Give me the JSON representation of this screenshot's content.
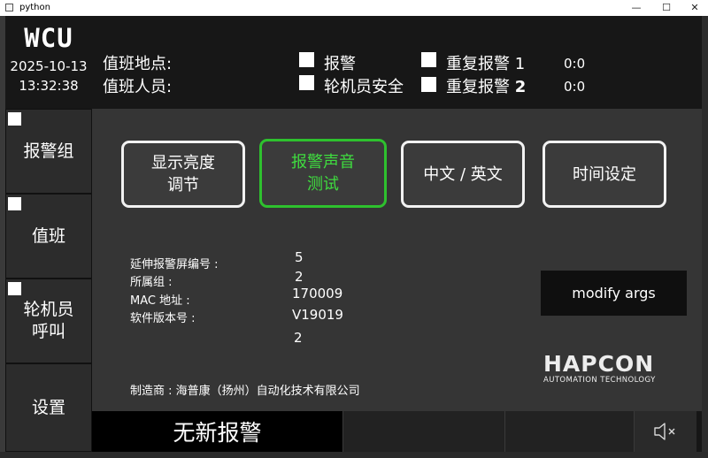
{
  "window": {
    "title": "python",
    "minimize": "—",
    "maximize": "☐",
    "close": "✕"
  },
  "header": {
    "logo": "WCU",
    "date": "2025-10-13",
    "time": "13:32:38",
    "duty_location_label": "值班地点:",
    "duty_person_label": "值班人员:",
    "alarm_label": "报警",
    "engineer_safe_label": "轮机员安全",
    "repeat_alarm_1_label": "重复报警",
    "repeat_alarm_1_num": "1",
    "repeat_alarm_2_label": "重复报警",
    "repeat_alarm_2_num": "2",
    "counter_1": "0:0",
    "counter_2": "0:0"
  },
  "nav": {
    "items": [
      {
        "label": "报警组"
      },
      {
        "label": "值班"
      },
      {
        "label": "轮机员\n呼叫"
      },
      {
        "label": "设置"
      }
    ]
  },
  "settings": {
    "buttons": [
      {
        "label": "显示亮度\n调节",
        "active": false
      },
      {
        "label": "报警声音\n测试",
        "active": true
      },
      {
        "label": "中文 / 英文",
        "active": false
      },
      {
        "label": "时间设定",
        "active": false
      }
    ],
    "info": {
      "screen_no_label": "延伸报警屏编号 :",
      "screen_no_value": "5",
      "group_label": "所属组 :",
      "group_value": "2",
      "mac_label": "MAC 地址 :",
      "mac_value": "170009",
      "version_label": "软件版本号 :",
      "version_value": "V19019",
      "extra_value": "2"
    },
    "modify_button": "modify args",
    "brand_name": "HAPCON",
    "brand_sub": "AUTOMATION TECHNOLOGY",
    "manufacturer": "制造商 : 海普康（扬州）自动化技术有限公司"
  },
  "status_bar": {
    "alarm_status": "无新报警",
    "mute_icon": "speaker-muted-icon"
  },
  "colors": {
    "active_border": "#2ec12e",
    "active_text": "#3fdc3f",
    "panel": "#353535",
    "header": "#171717"
  }
}
